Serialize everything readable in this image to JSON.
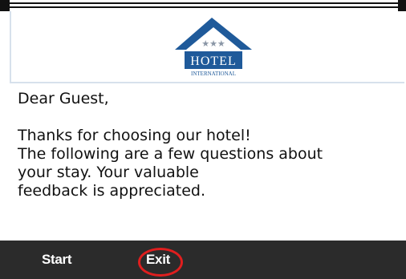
{
  "logo": {
    "icon": "hotel-mountain-logo",
    "brand_text": "HOTEL",
    "sub_text": "INTERNATIONAL",
    "stars": "★★★",
    "colors": {
      "mountain": "#1f5a9a",
      "banner": "#1f5a9a",
      "text": "#ffffff"
    }
  },
  "message": {
    "greeting": "Dear Guest,",
    "lines": [
      "Thanks for choosing our hotel!",
      "The following are a few questions about",
      "your stay. Your valuable",
      "feedback is appreciated."
    ]
  },
  "actions": {
    "start_label": "Start",
    "exit_label": "Exit"
  },
  "colors": {
    "bottom_bar": "#2b2b2b",
    "highlight": "#e01e1e"
  }
}
